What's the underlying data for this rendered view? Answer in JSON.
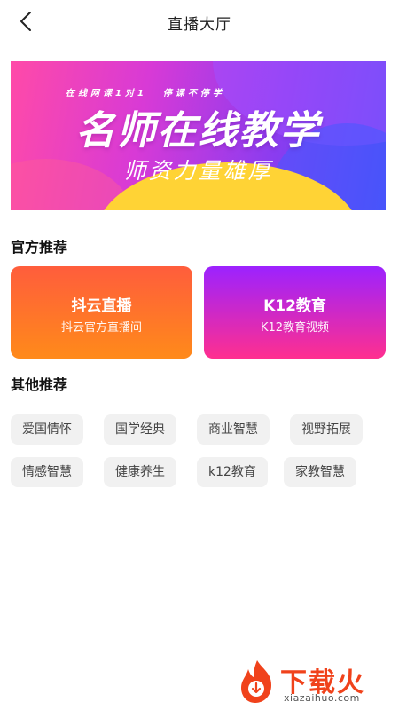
{
  "header": {
    "title": "直播大厅",
    "back_icon": "chevron-left-icon"
  },
  "banner": {
    "subtitle_left": "在线网课1对1",
    "subtitle_right": "停课不停学",
    "title": "名师在线教学",
    "slogan": "师资力量雄厚"
  },
  "sections": {
    "official": {
      "title": "官方推荐"
    },
    "other": {
      "title": "其他推荐"
    }
  },
  "official_cards": [
    {
      "title": "抖云直播",
      "subtitle": "抖云官方直播间",
      "color_top": "#ff5d3c",
      "color_bottom": "#ff8a1a"
    },
    {
      "title": "K12教育",
      "subtitle": "K12教育视频",
      "color_top": "#9c22ff",
      "color_bottom": "#ff2f8f"
    }
  ],
  "tags": [
    "爱国情怀",
    "国学经典",
    "商业智慧",
    "视野拓展",
    "情感智慧",
    "健康养生",
    "k12教育",
    "家教智慧"
  ],
  "watermark": {
    "logo_text": "下载火",
    "url": "xiazaihuo.com",
    "color": "#f0421b"
  }
}
